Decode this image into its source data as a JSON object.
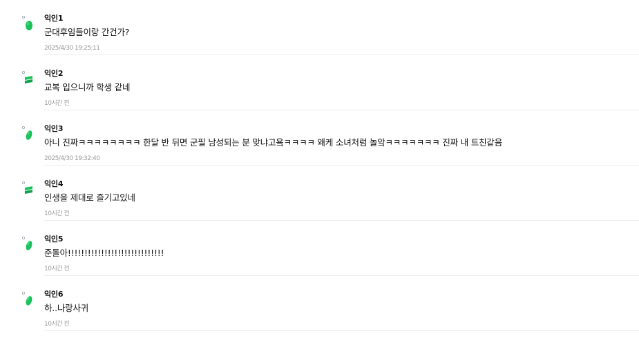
{
  "comments": [
    {
      "author": "익인1",
      "text": "군대후임들이랑 간건가?",
      "time": "2025/4/30 19:25:11",
      "avatar_style": "round"
    },
    {
      "author": "익인2",
      "text": "교복 입으니까 학생 같네",
      "time": "10시간 전",
      "avatar_style": "stack"
    },
    {
      "author": "익인3",
      "text": "아니 진짜ㅋㅋㅋㅋㅋㅋㅋㅋ 한달 반 뒤면 군필 남성되는 분 맞냐고욬ㅋㅋㅋㅋ 왜케 소녀처럼 놀앜ㅋㅋㅋㅋㅋㅋㅋ 진짜 내 트친같음",
      "time": "2025/4/30 19:32:40",
      "avatar_style": "round"
    },
    {
      "author": "익인4",
      "text": "인생을 제대로 즐기고있네",
      "time": "10시간 전",
      "avatar_style": "stack"
    },
    {
      "author": "익인5",
      "text": "준돌아!!!!!!!!!!!!!!!!!!!!!!!!!!!!!",
      "time": "10시간 전",
      "avatar_style": "round"
    },
    {
      "author": "익인6",
      "text": "하..나랑사귀",
      "time": "10시간 전",
      "avatar_style": "round"
    }
  ],
  "colors": {
    "avatar_green": "#19c25a",
    "avatar_green_dark": "#0ea24a",
    "avatar_dot": "#9aa3ad",
    "divider": "#ececec",
    "timestamp": "#9a9a9a"
  }
}
